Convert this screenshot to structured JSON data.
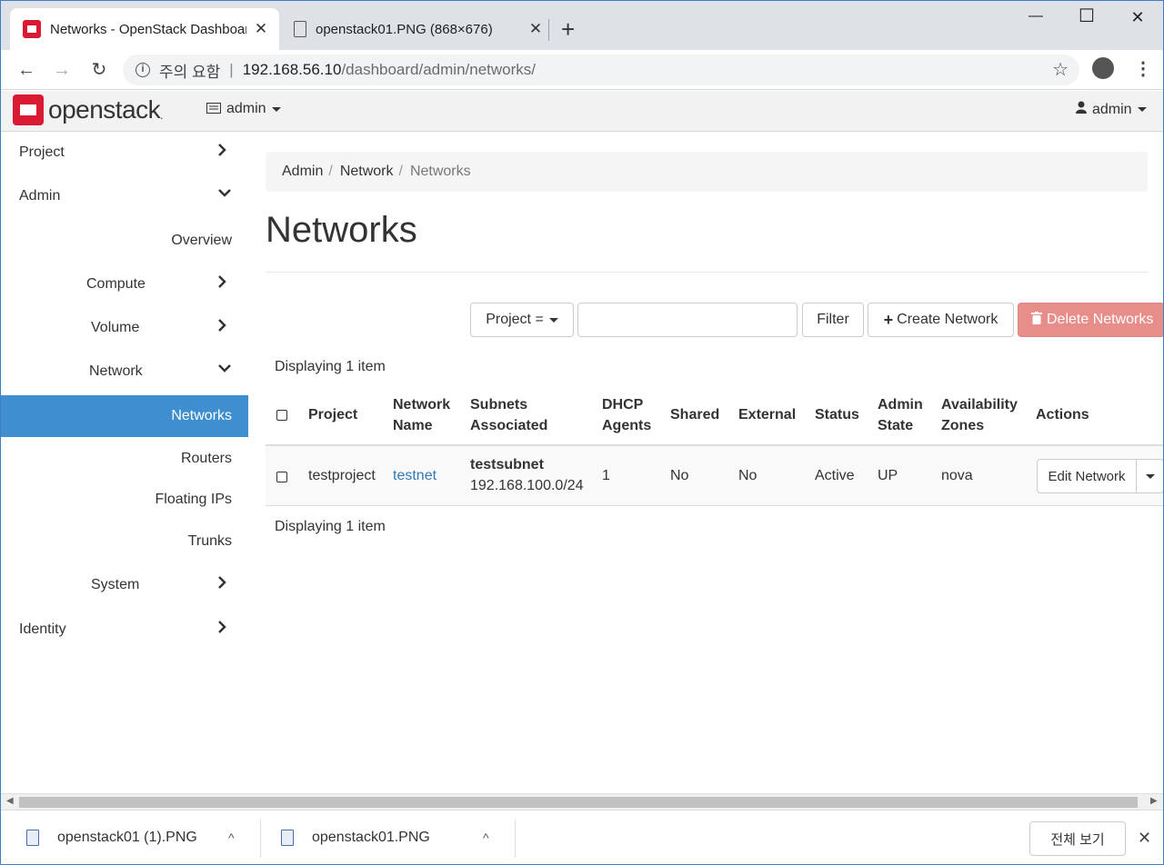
{
  "browser": {
    "tabs": [
      {
        "title": "Networks - OpenStack Dashboard",
        "close": "✕"
      },
      {
        "title": "openstack01.PNG (868×676)",
        "close": "✕"
      }
    ],
    "new_tab": "+",
    "window_controls": {
      "minimize": "—",
      "maximize": "☐",
      "close": "✕"
    },
    "nav": {
      "back": "←",
      "forward": "→",
      "reload": "↻"
    },
    "address": {
      "info": "i",
      "warning": "주의 요함",
      "separator": "|",
      "host": "192.168.56.10",
      "path": "/dashboard/admin/networks/"
    },
    "bookmark": "☆",
    "menu": "⋮"
  },
  "header": {
    "brand": "openstack",
    "brand_mark": ".",
    "project_menu": "admin",
    "user_menu": "admin"
  },
  "sidebar": {
    "items": [
      {
        "label": "Project",
        "chevron": "›"
      },
      {
        "label": "Admin",
        "chevron": "⌄"
      },
      {
        "label": "Overview"
      },
      {
        "label": "Compute",
        "chevron": "›"
      },
      {
        "label": "Volume",
        "chevron": "›"
      },
      {
        "label": "Network",
        "chevron": "⌄"
      },
      {
        "label": "Networks"
      },
      {
        "label": "Routers"
      },
      {
        "label": "Floating IPs"
      },
      {
        "label": "Trunks"
      },
      {
        "label": "System",
        "chevron": "›"
      },
      {
        "label": "Identity",
        "chevron": "›"
      }
    ]
  },
  "breadcrumb": {
    "items": [
      "Admin",
      "Network",
      "Networks"
    ],
    "separator": "/"
  },
  "page": {
    "title": "Networks"
  },
  "filters": {
    "select_label": "Project =",
    "filter_button": "Filter",
    "create_button": "Create Network",
    "delete_button": "Delete Networks"
  },
  "table": {
    "count_top": "Displaying 1 item",
    "count_bottom": "Displaying 1 item",
    "headers": {
      "project": "Project",
      "network_name_1": "Network",
      "network_name_2": "Name",
      "subnets_1": "Subnets",
      "subnets_2": "Associated",
      "dhcp_1": "DHCP",
      "dhcp_2": "Agents",
      "shared": "Shared",
      "external": "External",
      "status": "Status",
      "admin_1": "Admin",
      "admin_2": "State",
      "az_1": "Availability",
      "az_2": "Zones",
      "actions": "Actions"
    },
    "rows": [
      {
        "project": "testproject",
        "network_name": "testnet",
        "subnet_name": "testsubnet",
        "subnet_cidr": "192.168.100.0/24",
        "dhcp_agents": "1",
        "shared": "No",
        "external": "No",
        "status": "Active",
        "admin_state": "UP",
        "zones": "nova",
        "action": "Edit Network"
      }
    ]
  },
  "downloads": {
    "items": [
      {
        "name": "openstack01 (1).PNG"
      },
      {
        "name": "openstack01.PNG"
      }
    ],
    "expand": "^",
    "show_all": "전체 보기",
    "close": "✕"
  },
  "colors": {
    "accent": "#3f8ecf",
    "brand_red": "#da1a32",
    "danger": "#e88e8a",
    "link": "#337ab7"
  }
}
